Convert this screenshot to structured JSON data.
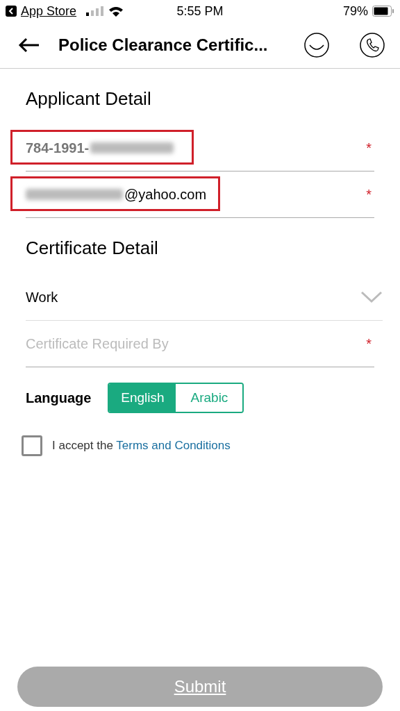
{
  "status_bar": {
    "back_app": "App Store",
    "time": "5:55 PM",
    "battery": "79%"
  },
  "header": {
    "title": "Police Clearance Certific..."
  },
  "sections": [
    {
      "title": "Applicant Detail",
      "fields": [
        {
          "kind": "text",
          "value": "784-1991-",
          "redacted_before": false,
          "redacted_after": true,
          "required_mark": "*",
          "highlighted": true
        },
        {
          "kind": "text",
          "value": "@yahoo.com",
          "redacted_before": true,
          "redacted_after": false,
          "required_mark": "*",
          "highlighted": true
        }
      ]
    },
    {
      "title": "Certificate Detail",
      "fields": [
        {
          "kind": "select",
          "value": "Work",
          "highlighted": false
        },
        {
          "kind": "text",
          "placeholder": "Certificate Required By",
          "required_mark": "*",
          "highlighted": false
        }
      ]
    }
  ],
  "language": {
    "label": "Language",
    "options": [
      {
        "label": "English",
        "selected": true
      },
      {
        "label": "Arabic",
        "selected": false
      }
    ]
  },
  "terms": {
    "text": "I accept the",
    "link": "Terms and Conditions",
    "checked": false
  },
  "submit": {
    "label": "Submit",
    "disabled": true
  }
}
